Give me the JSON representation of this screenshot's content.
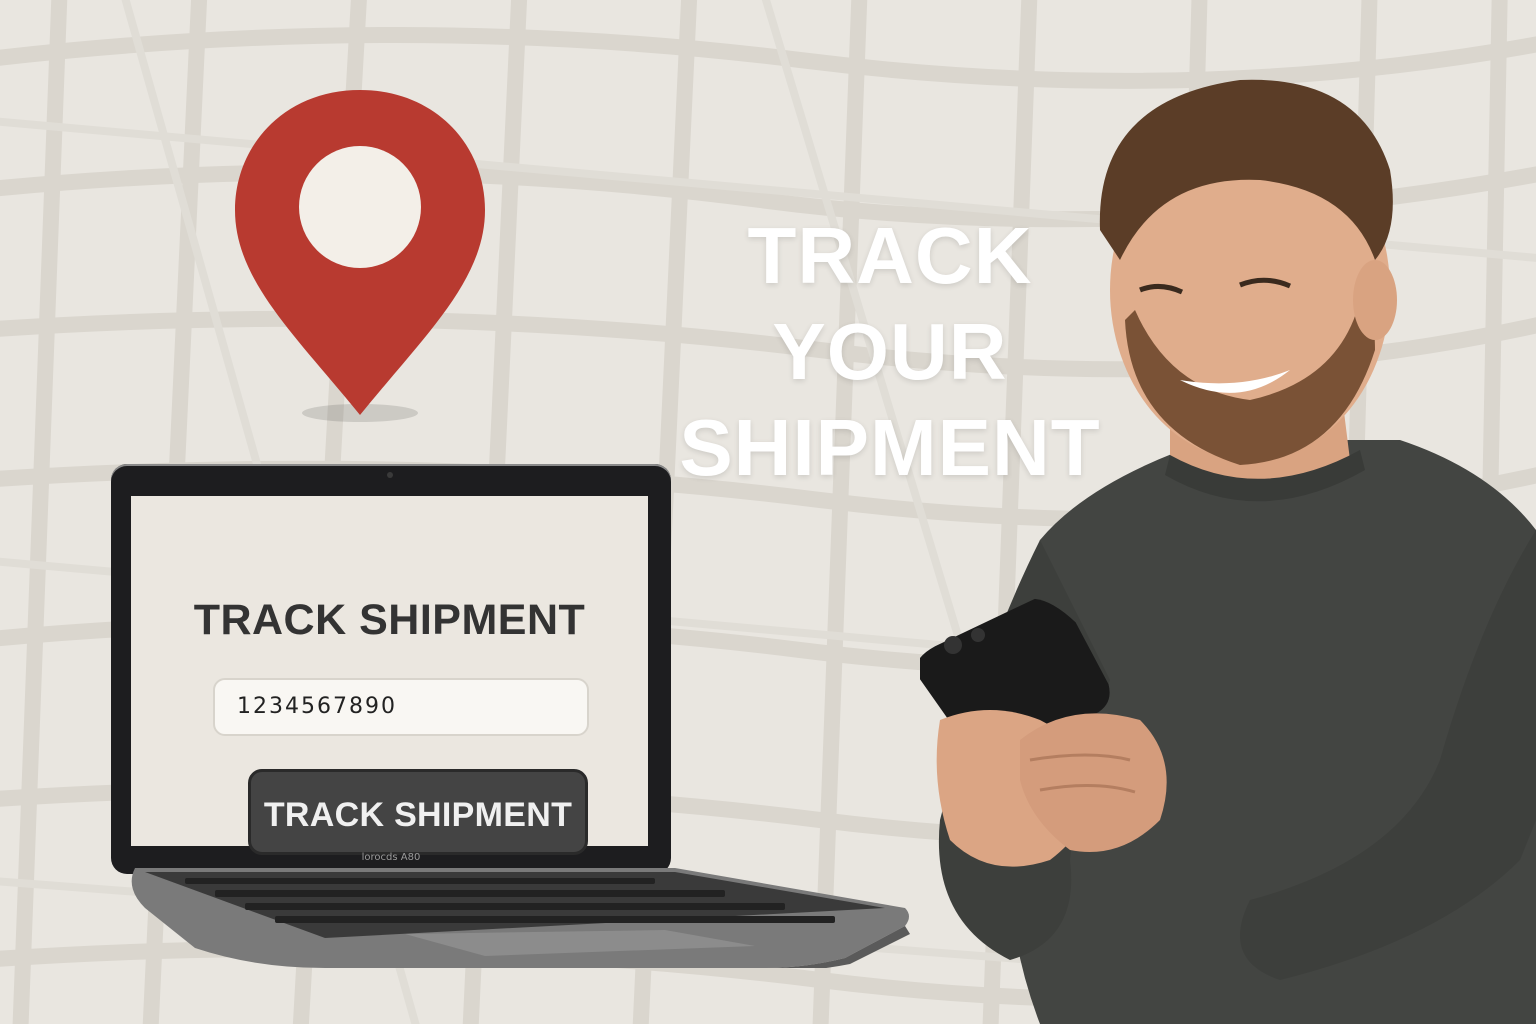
{
  "hero": {
    "lines": [
      "TRACK",
      "YOUR",
      "SHIPMENT"
    ]
  },
  "laptop": {
    "brand": "lorocds A80",
    "screen": {
      "title": "TRACK SHIPMENT",
      "tracking_input_value": "1234567890",
      "button_label": "TRACK SHIPMENT"
    }
  },
  "icons": {
    "pin": "location-pin-icon",
    "phone": "smartphone-icon"
  },
  "colors": {
    "background": "#e9e6e0",
    "pin": "#b83a30",
    "pin_center": "#f3efe8",
    "button": "#444444",
    "hero_text": "#ffffff"
  }
}
